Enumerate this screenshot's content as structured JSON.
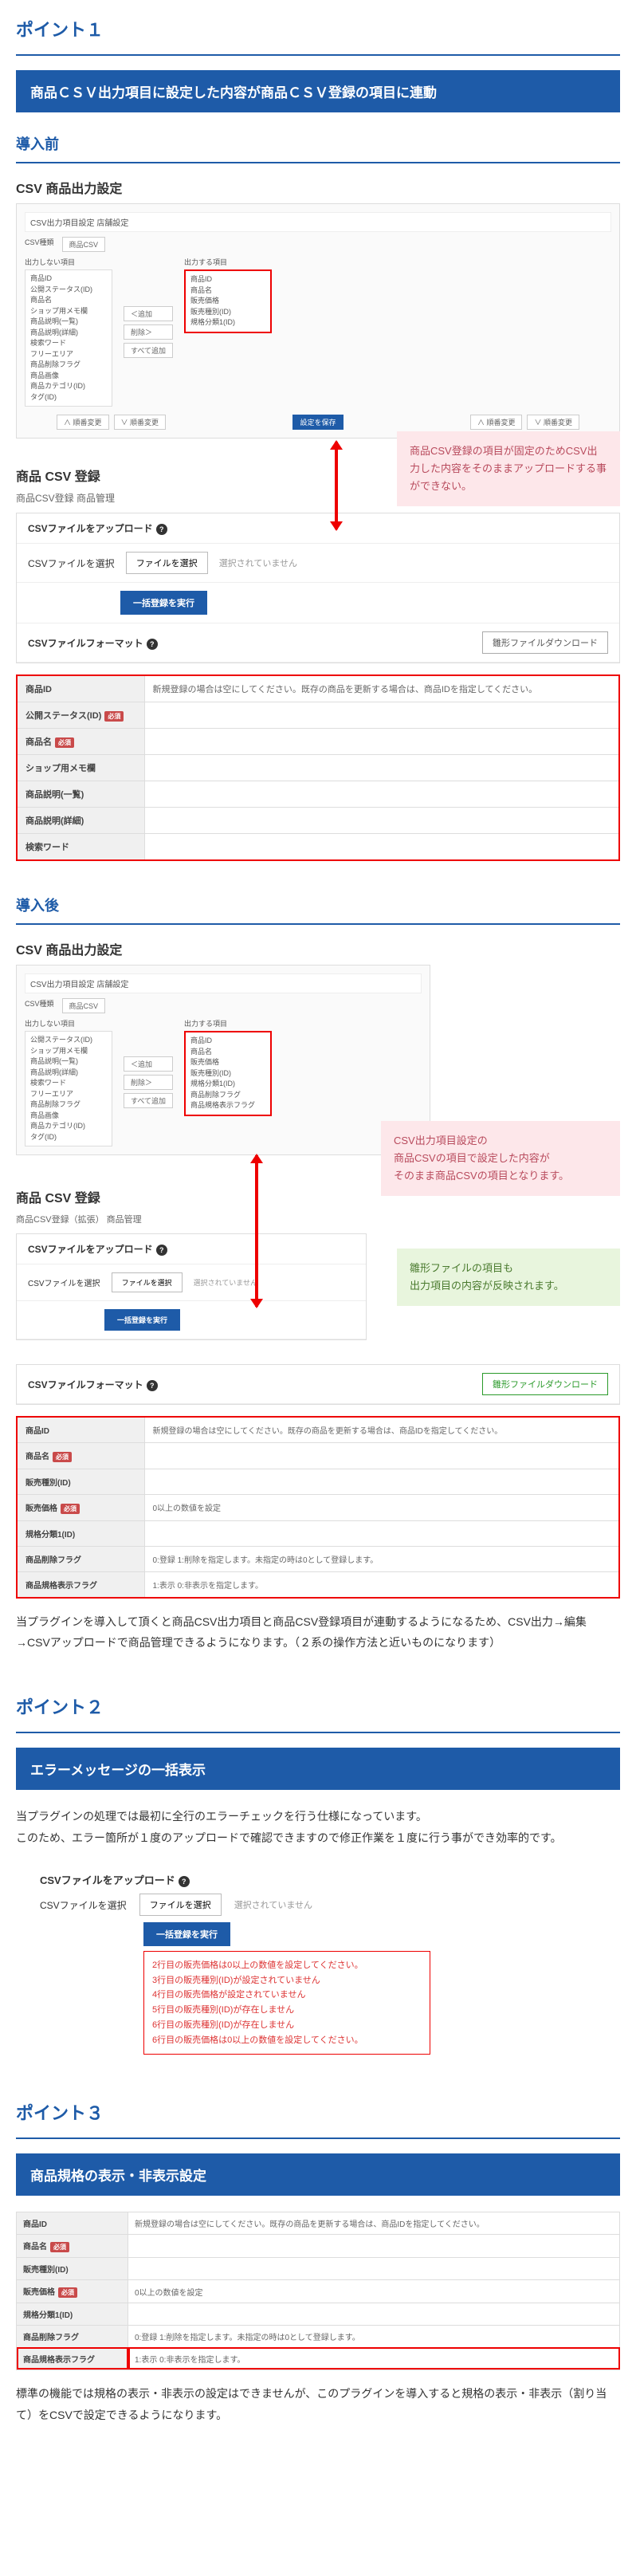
{
  "point1": {
    "title": "ポイント１",
    "banner": "商品ＣＳＶ出力項目に設定した内容が商品ＣＳＶ登録の項目に連動",
    "before": {
      "heading": "導入前",
      "panel1_title": "CSV 商品出力設定",
      "header_bar": "CSV出力項目設定  店舗設定",
      "csv_kind_label": "CSV種類",
      "csv_kind_value": "商品CSV",
      "not_output_label": "出力しない項目",
      "output_label": "出力する項目",
      "left_list": [
        "商品ID",
        "公開ステータス(ID)",
        "商品名",
        "ショップ用メモ欄",
        "商品説明(一覧)",
        "商品説明(詳細)",
        "検索ワード",
        "フリーエリア",
        "商品削除フラグ",
        "商品画像",
        "商品カテゴリ(ID)",
        "タグ(ID)"
      ],
      "right_list": [
        "商品ID",
        "商品名",
        "販売価格",
        "販売種別(ID)",
        "規格分類1(ID)"
      ],
      "btn_up": "∧ 順番変更",
      "btn_down": "∨ 順番変更",
      "btn_add": "＜追加",
      "btn_del": "削除＞",
      "btn_all": "すべて追加",
      "btn_save": "設定を保存",
      "panel2_title": "商品 CSV 登録",
      "breadcrumb": "商品CSV登録 商品管理",
      "upload_label": "CSVファイルをアップロード",
      "file_label": "CSVファイルを選択",
      "file_btn": "ファイルを選択",
      "file_status": "選択されていません",
      "run_btn": "一括登録を実行",
      "format_label": "CSVファイルフォーマット",
      "dl_btn": "雛形ファイルダウンロード",
      "table_rows": [
        {
          "th": "商品ID",
          "td": "新規登録の場合は空にしてください。既存の商品を更新する場合は、商品IDを指定してください。"
        },
        {
          "th": "公開ステータス(ID)",
          "tag": "必須",
          "td": ""
        },
        {
          "th": "商品名",
          "tag": "必須",
          "td": ""
        },
        {
          "th": "ショップ用メモ欄",
          "td": ""
        },
        {
          "th": "商品説明(一覧)",
          "td": ""
        },
        {
          "th": "商品説明(詳細)",
          "td": ""
        },
        {
          "th": "検索ワード",
          "td": ""
        }
      ],
      "bubble": "商品CSV登録の項目が固定のためCSV出力した内容をそのままアップロードする事ができない。"
    },
    "after": {
      "heading": "導入後",
      "panel1_title": "CSV 商品出力設定",
      "header_bar": "CSV出力項目設定  店舗設定",
      "csv_kind_value": "商品CSV",
      "not_output_label": "出力しない項目",
      "output_label": "出力する項目",
      "left_list": [
        "公開ステータス(ID)",
        "ショップ用メモ欄",
        "商品説明(一覧)",
        "商品説明(詳細)",
        "検索ワード",
        "フリーエリア",
        "商品削除フラグ",
        "商品画像",
        "商品カテゴリ(ID)",
        "タグ(ID)"
      ],
      "right_list": [
        "商品ID",
        "商品名",
        "販売価格",
        "販売種別(ID)",
        "規格分類1(ID)",
        "商品削除フラグ",
        "商品規格表示フラグ"
      ],
      "bubble1": "CSV出力項目設定の\n商品CSVの項目で設定した内容が\nそのまま商品CSVの項目となります。",
      "panel2_title": "商品 CSV 登録",
      "breadcrumb": "商品CSV登録（拡張） 商品管理",
      "bubble2": "雛形ファイルの項目も\n出力項目の内容が反映されます。",
      "dl_btn": "雛形ファイルダウンロード",
      "table_rows": [
        {
          "th": "商品ID",
          "td": "新規登録の場合は空にしてください。既存の商品を更新する場合は、商品IDを指定してください。"
        },
        {
          "th": "商品名",
          "tag": "必須",
          "td": ""
        },
        {
          "th": "販売種別(ID)",
          "td": ""
        },
        {
          "th": "販売価格",
          "tag": "必須",
          "td": "0以上の数値を設定"
        },
        {
          "th": "規格分類1(ID)",
          "td": ""
        },
        {
          "th": "商品削除フラグ",
          "td": "0:登録 1:削除を指定します。未指定の時は0として登録します。"
        },
        {
          "th": "商品規格表示フラグ",
          "td": "1:表示 0:非表示を指定します。"
        }
      ],
      "body": "当プラグインを導入して頂くと商品CSV出力項目と商品CSV登録項目が連動するようになるため、CSV出力→編集→CSVアップロードで商品管理できるようになります。（２系の操作方法と近いものになります）"
    }
  },
  "point2": {
    "title": "ポイント２",
    "banner": "エラーメッセージの一括表示",
    "body": "当プラグインの処理では最初に全行のエラーチェックを行う仕様になっています。\nこのため、エラー箇所が１度のアップロードで確認できますので修正作業を１度に行う事ができ効率的です。",
    "upload_label": "CSVファイルをアップロード",
    "file_label": "CSVファイルを選択",
    "file_btn": "ファイルを選択",
    "file_status": "選択されていません",
    "run_btn": "一括登録を実行",
    "errors": [
      "2行目の販売価格は0以上の数値を設定してください。",
      "3行目の販売種別(ID)が設定されていません",
      "4行目の販売価格が設定されていません",
      "5行目の販売種別(ID)が存在しません",
      "6行目の販売種別(ID)が存在しません",
      "6行目の販売価格は0以上の数値を設定してください。"
    ]
  },
  "point3": {
    "title": "ポイント３",
    "banner": "商品規格の表示・非表示設定",
    "table_rows": [
      {
        "th": "商品ID",
        "td": "新規登録の場合は空にしてください。既存の商品を更新する場合は、商品IDを指定してください。"
      },
      {
        "th": "商品名",
        "tag": "必須",
        "td": ""
      },
      {
        "th": "販売種別(ID)",
        "td": ""
      },
      {
        "th": "販売価格",
        "tag": "必須",
        "td": "0以上の数値を設定"
      },
      {
        "th": "規格分類1(ID)",
        "td": ""
      },
      {
        "th": "商品削除フラグ",
        "td": "0:登録 1:削除を指定します。未指定の時は0として登録します。"
      },
      {
        "th": "商品規格表示フラグ",
        "td": "1:表示 0:非表示を指定します。",
        "hl": true
      }
    ],
    "body": "標準の機能では規格の表示・非表示の設定はできませんが、このプラグインを導入すると規格の表示・非表示（割り当て）をCSVで設定できるようになります。"
  }
}
